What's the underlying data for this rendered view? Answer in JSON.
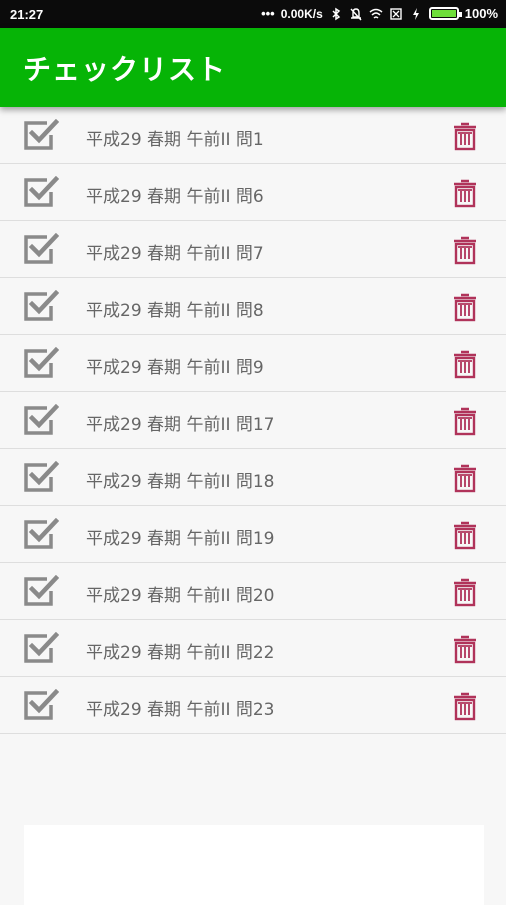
{
  "status_bar": {
    "time": "21:27",
    "network_speed": "0.00K/s",
    "battery": "100%",
    "icons": [
      "dots-icon",
      "bluetooth-icon",
      "mute-icon",
      "wifi-icon",
      "sim-icon",
      "charging-icon",
      "battery-icon"
    ]
  },
  "app_bar": {
    "title": "チェックリスト",
    "color": "#06b406"
  },
  "colors": {
    "check": "#8a8a8a",
    "trash": "#b0335a",
    "text": "#666666"
  },
  "list": {
    "items": [
      {
        "label": "平成29 春期 午前II 問1",
        "checked": true
      },
      {
        "label": "平成29 春期 午前II 問6",
        "checked": true
      },
      {
        "label": "平成29 春期 午前II 問7",
        "checked": true
      },
      {
        "label": "平成29 春期 午前II 問8",
        "checked": true
      },
      {
        "label": "平成29 春期 午前II 問9",
        "checked": true
      },
      {
        "label": "平成29 春期 午前II 問17",
        "checked": true
      },
      {
        "label": "平成29 春期 午前II 問18",
        "checked": true
      },
      {
        "label": "平成29 春期 午前II 問19",
        "checked": true
      },
      {
        "label": "平成29 春期 午前II 問20",
        "checked": true
      },
      {
        "label": "平成29 春期 午前II 問22",
        "checked": true
      },
      {
        "label": "平成29 春期 午前II 問23",
        "checked": true
      }
    ]
  }
}
